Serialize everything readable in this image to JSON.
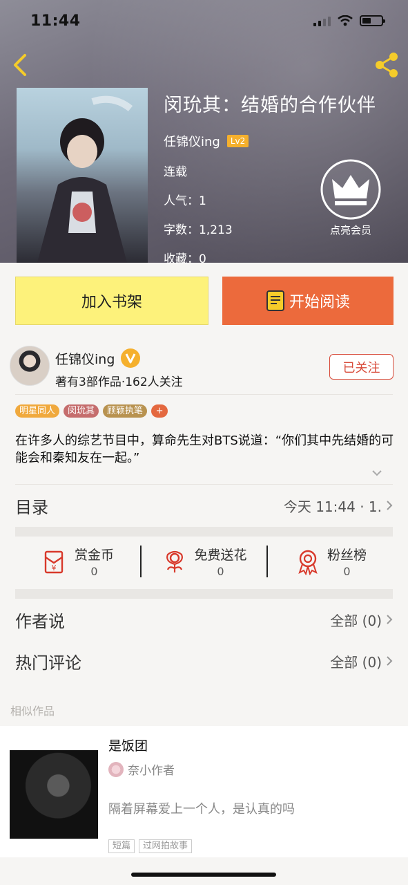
{
  "status_bar": {
    "time": "11:44"
  },
  "book": {
    "title": "闵玧其：结婚的合作伙伴",
    "author": "任锦仪ing",
    "author_level": "Lv2",
    "status": "连载",
    "popularity": "人气：1",
    "word_count": "字数：1,213",
    "favorites": "收藏：0",
    "vip_label": "点亮会员"
  },
  "actions": {
    "add_shelf": "加入书架",
    "start_reading": "开始阅读"
  },
  "author_row": {
    "name": "任锦仪ing",
    "stats": "著有3部作品·162人关注",
    "follow_label": "已关注"
  },
  "tags": [
    "明星同人",
    "闵玧其",
    "顾颖执笔",
    "+"
  ],
  "summary": "在许多人的综艺节目中，算命先生对BTS说道：“你们其中先结婚的可能会和秦知友在一起。”",
  "catalog": {
    "label": "目录",
    "latest": "今天 11:44 · 1."
  },
  "stats": [
    {
      "name": "赏金币",
      "value": "0",
      "icon": "red-envelope-icon"
    },
    {
      "name": "免费送花",
      "value": "0",
      "icon": "flower-icon"
    },
    {
      "name": "粉丝榜",
      "value": "0",
      "icon": "medal-icon"
    }
  ],
  "author_says": {
    "label": "作者说",
    "right": "全部 (0)"
  },
  "hot_comments": {
    "label": "热门评论",
    "right": "全部 (0)"
  },
  "similar": {
    "label": "相似作品",
    "item": {
      "title": "是饭团",
      "author": "奈小作者",
      "desc": "隔着屏幕爱上一个人，是认真的吗",
      "tags": [
        "短篇",
        "过网拍故事"
      ]
    }
  },
  "colors": {
    "accent": "#ec6a3c",
    "shelf": "#fdf27b",
    "follow": "#d84c3b",
    "icon_yellow": "#f5cc2a"
  }
}
